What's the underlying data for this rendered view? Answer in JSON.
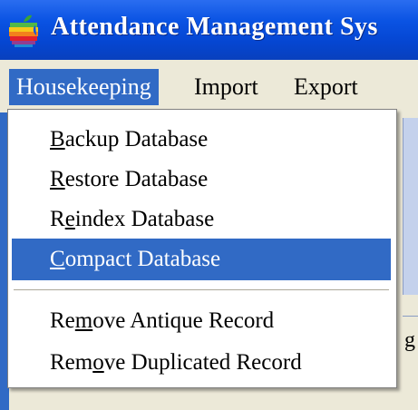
{
  "window": {
    "title": "Attendance Management Sys",
    "icon": "apple-icon"
  },
  "menubar": {
    "items": [
      {
        "label": "Housekeeping",
        "active": true
      },
      {
        "label": "Import"
      },
      {
        "label": "Export"
      }
    ]
  },
  "dropdown": {
    "items": [
      {
        "pre": "",
        "key": "B",
        "post": "ackup Database"
      },
      {
        "pre": "",
        "key": "R",
        "post": "estore Database"
      },
      {
        "pre": "R",
        "key": "e",
        "post": "index Database"
      },
      {
        "pre": "",
        "key": "C",
        "post": "ompact Database",
        "highlighted": true
      },
      {
        "pre": "Re",
        "key": "m",
        "post": "ove Antique Record"
      },
      {
        "pre": "Rem",
        "key": "o",
        "post": "ve Duplicated Record"
      }
    ]
  },
  "background": {
    "peek_char": "g"
  },
  "colors": {
    "highlight": "#316ac5",
    "titlebar": "#0a53e3",
    "menubar": "#ece9d8"
  }
}
